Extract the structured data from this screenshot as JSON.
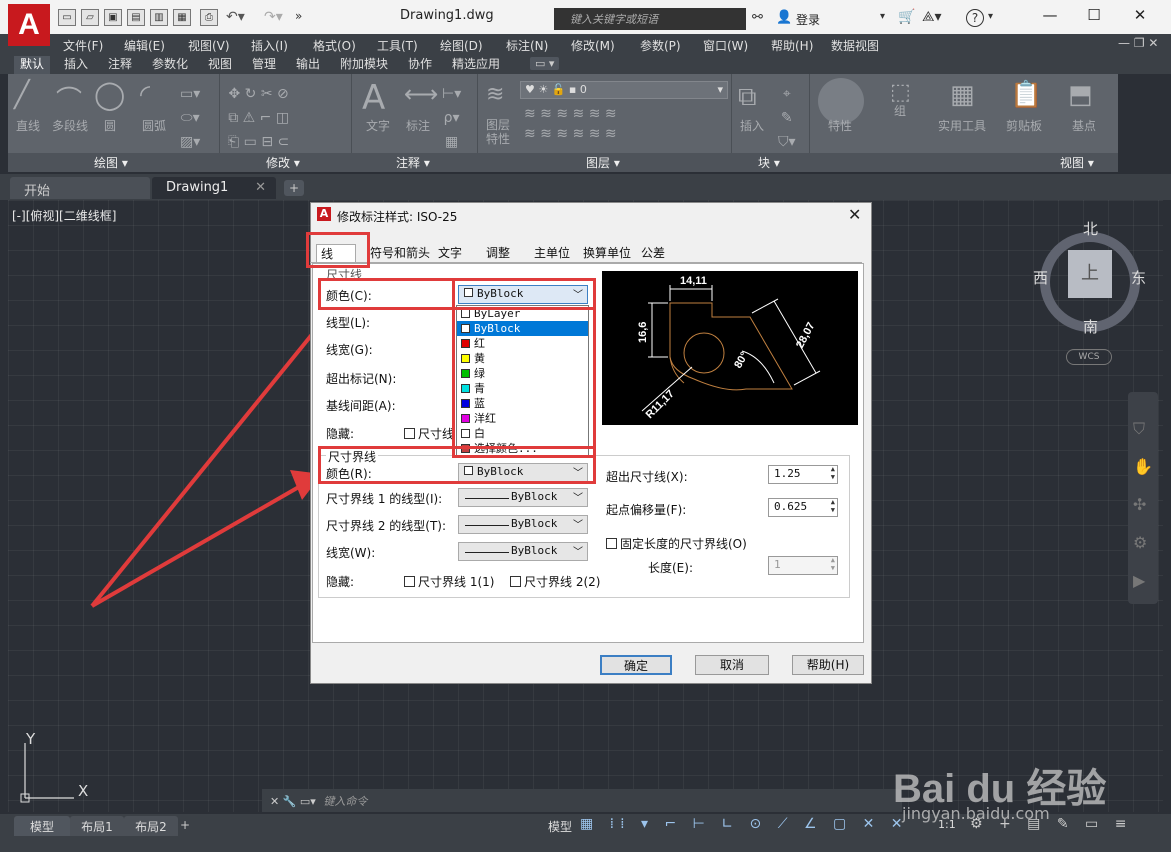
{
  "window": {
    "title": "Drawing1.dwg",
    "search_placeholder": "键入关键字或短语",
    "login": "登录",
    "app_letter": "A"
  },
  "menubar": [
    "文件(F)",
    "编辑(E)",
    "视图(V)",
    "插入(I)",
    "格式(O)",
    "工具(T)",
    "绘图(D)",
    "标注(N)",
    "修改(M)",
    "参数(P)",
    "窗口(W)",
    "帮助(H)",
    "数据视图"
  ],
  "ribbon_tabs": [
    "默认",
    "插入",
    "注释",
    "参数化",
    "视图",
    "管理",
    "输出",
    "附加模块",
    "协作",
    "精选应用"
  ],
  "ribbon": {
    "panels": [
      "绘图 ▾",
      "修改 ▾",
      "注释 ▾",
      "图层 ▾",
      "块 ▾",
      "视图 ▾"
    ],
    "draw_tools": [
      "直线",
      "多段线",
      "圆",
      "圆弧"
    ],
    "annot_tools": [
      "文字",
      "标注"
    ],
    "layer_tools": [
      "图层",
      "特性"
    ],
    "layer_value": "0",
    "block_tools": [
      "插入"
    ],
    "misc_tools": [
      "特性",
      "组",
      "实用工具",
      "剪贴板",
      "基点"
    ]
  },
  "doc_tabs": [
    "开始",
    "Drawing1"
  ],
  "viewport": {
    "label": "[-][俯视][二维线框]",
    "viewcube": {
      "top": "上",
      "north": "北",
      "south": "南",
      "east": "东",
      "west": "西",
      "wcs": "WCS"
    },
    "ucs_x": "X",
    "ucs_y": "Y"
  },
  "command_placeholder": "键入命令",
  "layout_tabs": [
    "模型",
    "布局1",
    "布局2"
  ],
  "status": {
    "model": "模型",
    "scale": "1:1"
  },
  "dialog": {
    "title": "修改标注样式: ISO-25",
    "tabs": [
      "线",
      "符号和箭头",
      "文字",
      "调整",
      "主单位",
      "换算单位",
      "公差"
    ],
    "dimline_group": "尺寸线",
    "dimline": {
      "color_label": "颜色(C):",
      "color_value": "ByBlock",
      "linetype_label": "线型(L):",
      "lineweight_label": "线宽(G):",
      "extend_label": "超出标记(N):",
      "baseline_label": "基线间距(A):",
      "suppress_label": "隐藏:",
      "suppress_check": "尺寸线"
    },
    "dropdown_options": [
      {
        "label": "ByLayer",
        "color": "#ffffff"
      },
      {
        "label": "ByBlock",
        "color": "#ffffff"
      },
      {
        "label": "红",
        "color": "#e00000"
      },
      {
        "label": "黄",
        "color": "#ffff00"
      },
      {
        "label": "绿",
        "color": "#00c000"
      },
      {
        "label": "青",
        "color": "#00e0e0"
      },
      {
        "label": "蓝",
        "color": "#0000e0"
      },
      {
        "label": "洋红",
        "color": "#e000e0"
      },
      {
        "label": "白",
        "color": "#ffffff"
      },
      {
        "label": "选择颜色...",
        "color": "#c04040"
      }
    ],
    "extline_group": "尺寸界线",
    "extline": {
      "color_label": "颜色(R):",
      "color_value": "ByBlock",
      "lt1_label": "尺寸界线 1 的线型(I):",
      "lt1_value": "ByBlock",
      "lt2_label": "尺寸界线 2 的线型(T):",
      "lt2_value": "ByBlock",
      "lw_label": "线宽(W):",
      "lw_value": "ByBlock",
      "suppress_label": "隐藏:",
      "suppress1": "尺寸界线 1(1)",
      "suppress2": "尺寸界线 2(2)",
      "beyond_label": "超出尺寸线(X):",
      "beyond_value": "1.25",
      "offset_label": "起点偏移量(F):",
      "offset_value": "0.625",
      "fixed_label": "固定长度的尺寸界线(O)",
      "length_label": "长度(E):",
      "length_value": "1"
    },
    "preview_labels": {
      "top": "14,11",
      "left": "16,6",
      "right": "28,07",
      "angle": "80°",
      "radius": "R11,17"
    },
    "buttons": {
      "ok": "确定",
      "cancel": "取消",
      "help": "帮助(H)"
    }
  },
  "watermark": {
    "main": "Bai du 经验",
    "sub": "jingyan.baidu.com"
  }
}
